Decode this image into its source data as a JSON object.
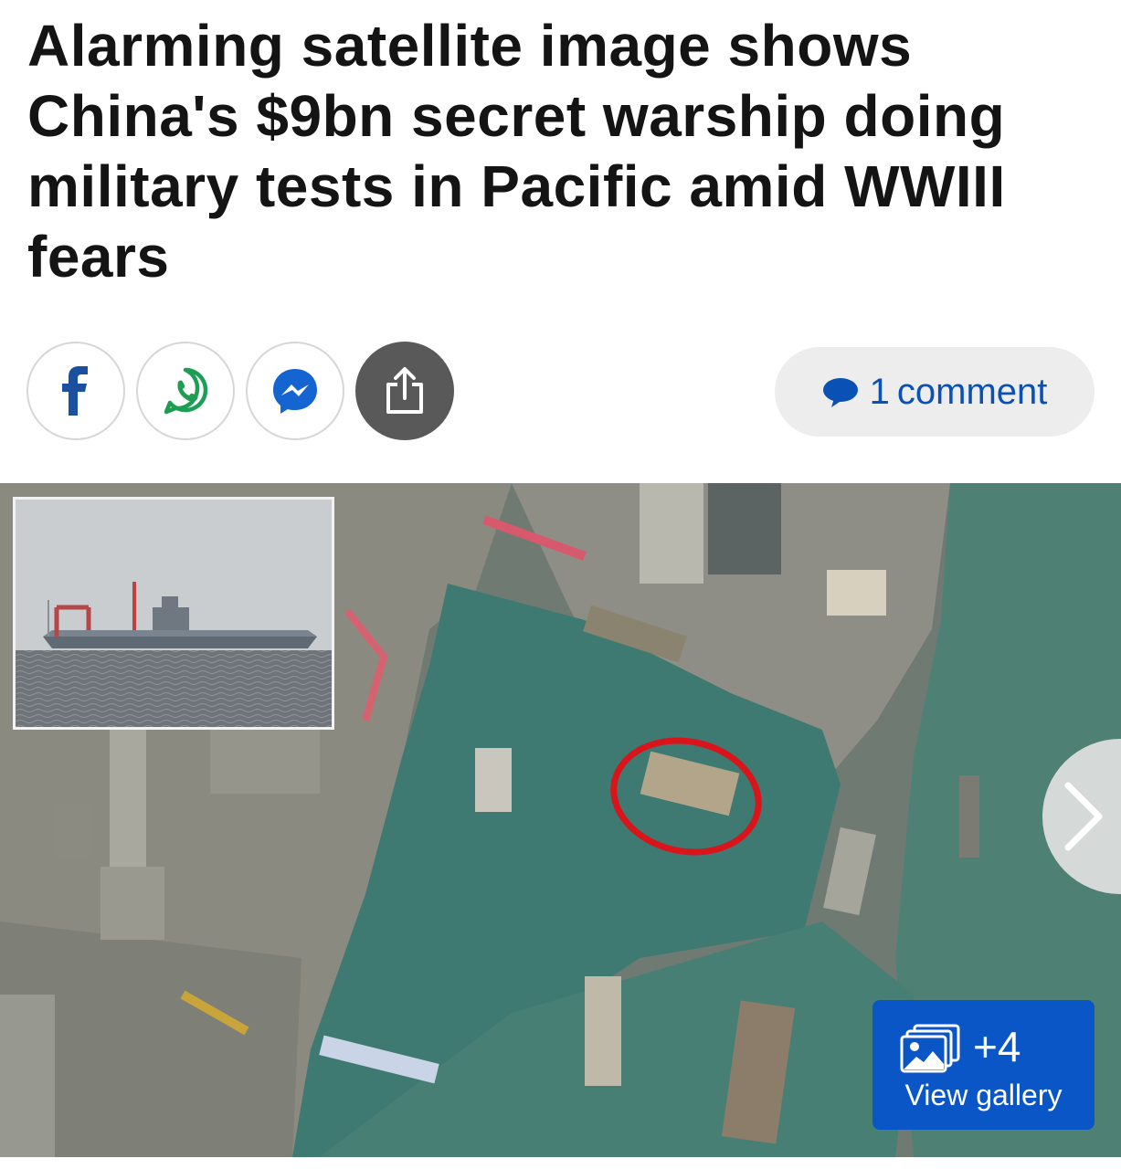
{
  "article": {
    "headline": "Alarming satellite image shows China's $9bn secret warship doing military tests in Pacific amid WWIII fears"
  },
  "share": {
    "buttons": [
      {
        "name": "facebook",
        "icon": "facebook-icon"
      },
      {
        "name": "whatsapp",
        "icon": "whatsapp-icon"
      },
      {
        "name": "messenger",
        "icon": "messenger-icon"
      },
      {
        "name": "share",
        "icon": "share-icon"
      }
    ],
    "comment_count": "1",
    "comment_label": "comment",
    "comment_icon": "speech-bubble-icon"
  },
  "gallery": {
    "count": "+4",
    "label": "View gallery",
    "icon": "gallery-icon",
    "next_icon": "chevron-right-icon"
  },
  "colors": {
    "brand_blue": "#0b56c6",
    "link_blue": "#0a51b5",
    "facebook_blue": "#1b4fa0",
    "whatsapp_green": "#1e9e55",
    "share_grey": "#595959"
  }
}
